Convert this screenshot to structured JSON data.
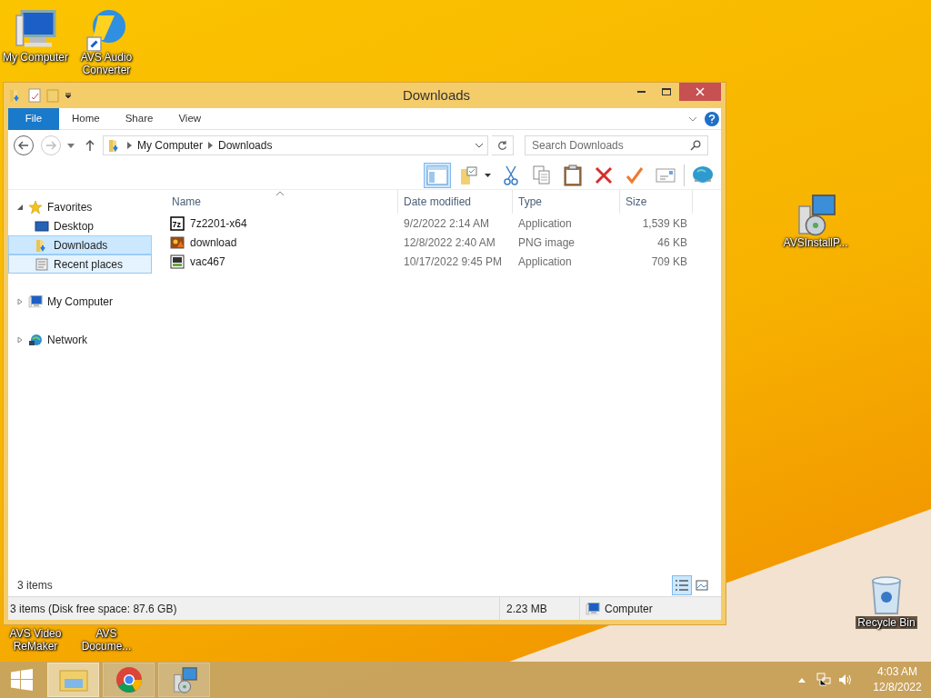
{
  "desktop_icons": [
    {
      "label": "My Computer",
      "kind": "computer"
    },
    {
      "label": "AVS Audio Converter",
      "kind": "converter"
    },
    {
      "label": "AVSInstallP...",
      "kind": "installer"
    },
    {
      "label": "Recycle Bin",
      "kind": "recycle"
    },
    {
      "label": "AVS Video ReMaker",
      "kind": "video"
    },
    {
      "label": "AVS Docume...",
      "kind": "document"
    }
  ],
  "window": {
    "title": "Downloads",
    "ribbon_tabs": [
      {
        "label": "File",
        "kind": "file",
        "selected": false
      },
      {
        "label": "Home",
        "kind": "tab",
        "selected": false
      },
      {
        "label": "Share",
        "kind": "tab",
        "selected": false
      },
      {
        "label": "View",
        "kind": "tab",
        "selected": false
      }
    ],
    "address": {
      "segments": [
        "My Computer",
        "Downloads"
      ],
      "search_placeholder": "Search Downloads"
    },
    "nav": [
      {
        "label": "Favorites",
        "kind": "star",
        "expanded": true,
        "children": [
          {
            "label": "Desktop",
            "kind": "desktop",
            "selected": false,
            "hovered": false
          },
          {
            "label": "Downloads",
            "kind": "downloads",
            "selected": true,
            "hovered": false
          },
          {
            "label": "Recent places",
            "kind": "recent",
            "selected": false,
            "hovered": true
          }
        ]
      },
      {
        "label": "My Computer",
        "kind": "computer",
        "expanded": false
      },
      {
        "label": "Network",
        "kind": "network",
        "expanded": false
      }
    ],
    "columns": [
      "Name",
      "Date modified",
      "Type",
      "Size"
    ],
    "rows": [
      {
        "name": "7z2201-x64",
        "kind": "7z",
        "date": "9/2/2022 2:14 AM",
        "type": "Application",
        "size": "1,539 KB"
      },
      {
        "name": "download",
        "kind": "image",
        "date": "12/8/2022 2:40 AM",
        "type": "PNG image",
        "size": "46 KB"
      },
      {
        "name": "vac467",
        "kind": "setup",
        "date": "10/17/2022 9:45 PM",
        "type": "Application",
        "size": "709 KB"
      }
    ],
    "item_count": "3 items",
    "views": [
      {
        "kind": "details",
        "selected": true
      },
      {
        "kind": "large",
        "selected": false
      }
    ],
    "status_bar": {
      "summary": "3 items (Disk free space: 87.6 GB)",
      "size": "2.23 MB",
      "location": "Computer"
    }
  },
  "taskbar": {
    "buttons": [
      {
        "kind": "explorer",
        "selected": true
      },
      {
        "kind": "chrome",
        "selected": false
      },
      {
        "kind": "installer",
        "selected": false
      }
    ],
    "time": "4:03 AM",
    "date": "12/8/2022"
  }
}
